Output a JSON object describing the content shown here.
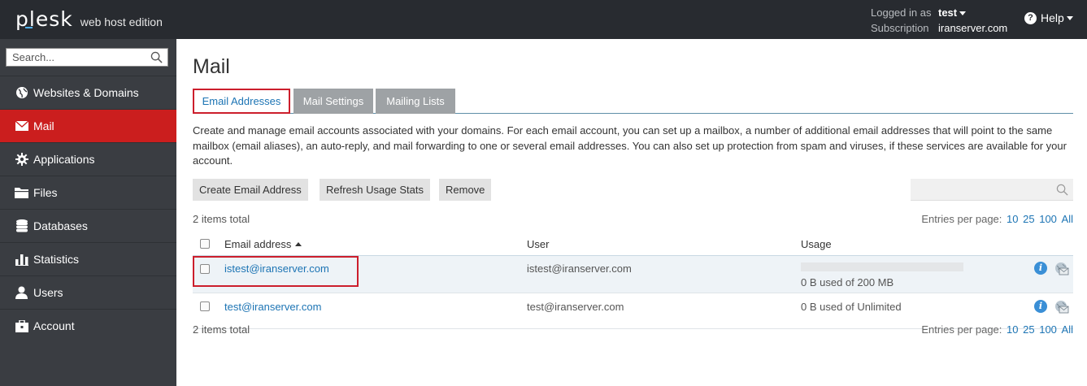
{
  "header": {
    "logo_main": "plesk",
    "logo_sub": "web host edition",
    "logged_in_label": "Logged in as",
    "user": "test",
    "subscription_label": "Subscription",
    "subscription": "iranserver.com",
    "help": "Help"
  },
  "sidebar": {
    "search_placeholder": "Search...",
    "items": [
      {
        "label": "Websites & Domains",
        "icon": "globe-icon"
      },
      {
        "label": "Mail",
        "icon": "envelope-icon",
        "active": true
      },
      {
        "label": "Applications",
        "icon": "gear-icon"
      },
      {
        "label": "Files",
        "icon": "folder-icon"
      },
      {
        "label": "Databases",
        "icon": "database-icon"
      },
      {
        "label": "Statistics",
        "icon": "bar-chart-icon"
      },
      {
        "label": "Users",
        "icon": "user-icon"
      },
      {
        "label": "Account",
        "icon": "briefcase-icon"
      }
    ]
  },
  "main": {
    "title": "Mail",
    "tabs": [
      {
        "label": "Email Addresses",
        "active": true
      },
      {
        "label": "Mail Settings"
      },
      {
        "label": "Mailing Lists"
      }
    ],
    "description": "Create and manage email accounts associated with your domains. For each email account, you can set up a mailbox, a number of additional email addresses that will point to the same mailbox (email aliases), an auto-reply, and mail forwarding to one or several email addresses. You can also set up protection from spam and viruses, if these services are available for your account.",
    "buttons": {
      "create": "Create Email Address",
      "refresh": "Refresh Usage Stats",
      "remove": "Remove"
    },
    "items_total": "2 items total",
    "entries_label": "Entries per page:",
    "entries_options": [
      "10",
      "25",
      "100",
      "All"
    ],
    "table": {
      "headers": {
        "email": "Email address",
        "user": "User",
        "usage": "Usage"
      },
      "rows": [
        {
          "email": "istest@iranserver.com",
          "user": "istest@iranserver.com",
          "usage": "0 B used of 200 MB",
          "usage_fraction": 0
        },
        {
          "email": "test@iranserver.com",
          "user": "test@iranserver.com",
          "usage": "0 B used of Unlimited"
        }
      ]
    }
  },
  "colors": {
    "topbar": "#282b30",
    "sidebar": "#3a3d42",
    "active_nav": "#cb1e1e",
    "link": "#1c74b4",
    "highlight": "#cc1e2c"
  }
}
